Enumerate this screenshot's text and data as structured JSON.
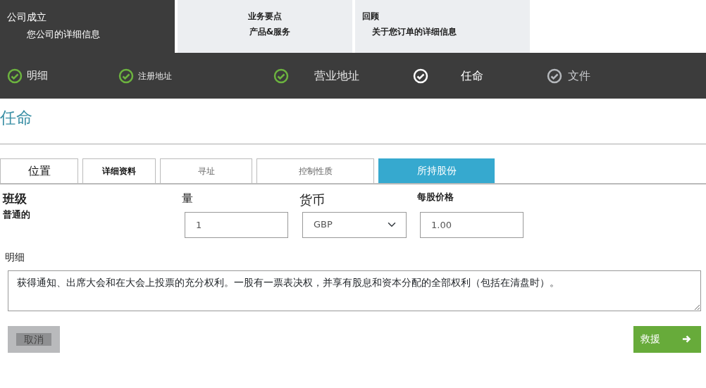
{
  "stages": [
    {
      "title": "公司成立",
      "subtitle": "您公司的详细信息",
      "selected": true
    },
    {
      "title": "业务要点",
      "subtitle": "产品&服务",
      "selected": false
    },
    {
      "title": "回顾",
      "subtitle": "关于您订单的详细信息",
      "selected": false
    }
  ],
  "steps": [
    {
      "label": "明细",
      "completed": true,
      "selected": false
    },
    {
      "label": "注册地址",
      "completed": true,
      "selected": false
    },
    {
      "label": "营业地址",
      "completed": true,
      "selected": false
    },
    {
      "label": "任命",
      "completed": false,
      "selected": true
    },
    {
      "label": "文件",
      "completed": false,
      "selected": false
    }
  ],
  "heading": "任命",
  "tabs": [
    {
      "label": "位置",
      "selected": false
    },
    {
      "label": "详细资料",
      "selected": false
    },
    {
      "label": "寻址",
      "selected": false
    },
    {
      "label": "控制性质",
      "selected": false
    },
    {
      "label": "所持股份",
      "selected": true
    }
  ],
  "form": {
    "class_label": "班级",
    "class_value": "普通的",
    "quantity_label": "量",
    "quantity_value": "1",
    "currency_label": "货币",
    "currency_value": "GBP",
    "price_label": "每股价格",
    "price_value": "1.00",
    "details_label": "明细",
    "details_value": "获得通知、出席大会和在大会上投票的充分权利。一股有一票表决权，并享有股息和资本分配的全部权利（包括在清盘时）。"
  },
  "buttons": {
    "cancel": "取消",
    "save": "救援"
  }
}
